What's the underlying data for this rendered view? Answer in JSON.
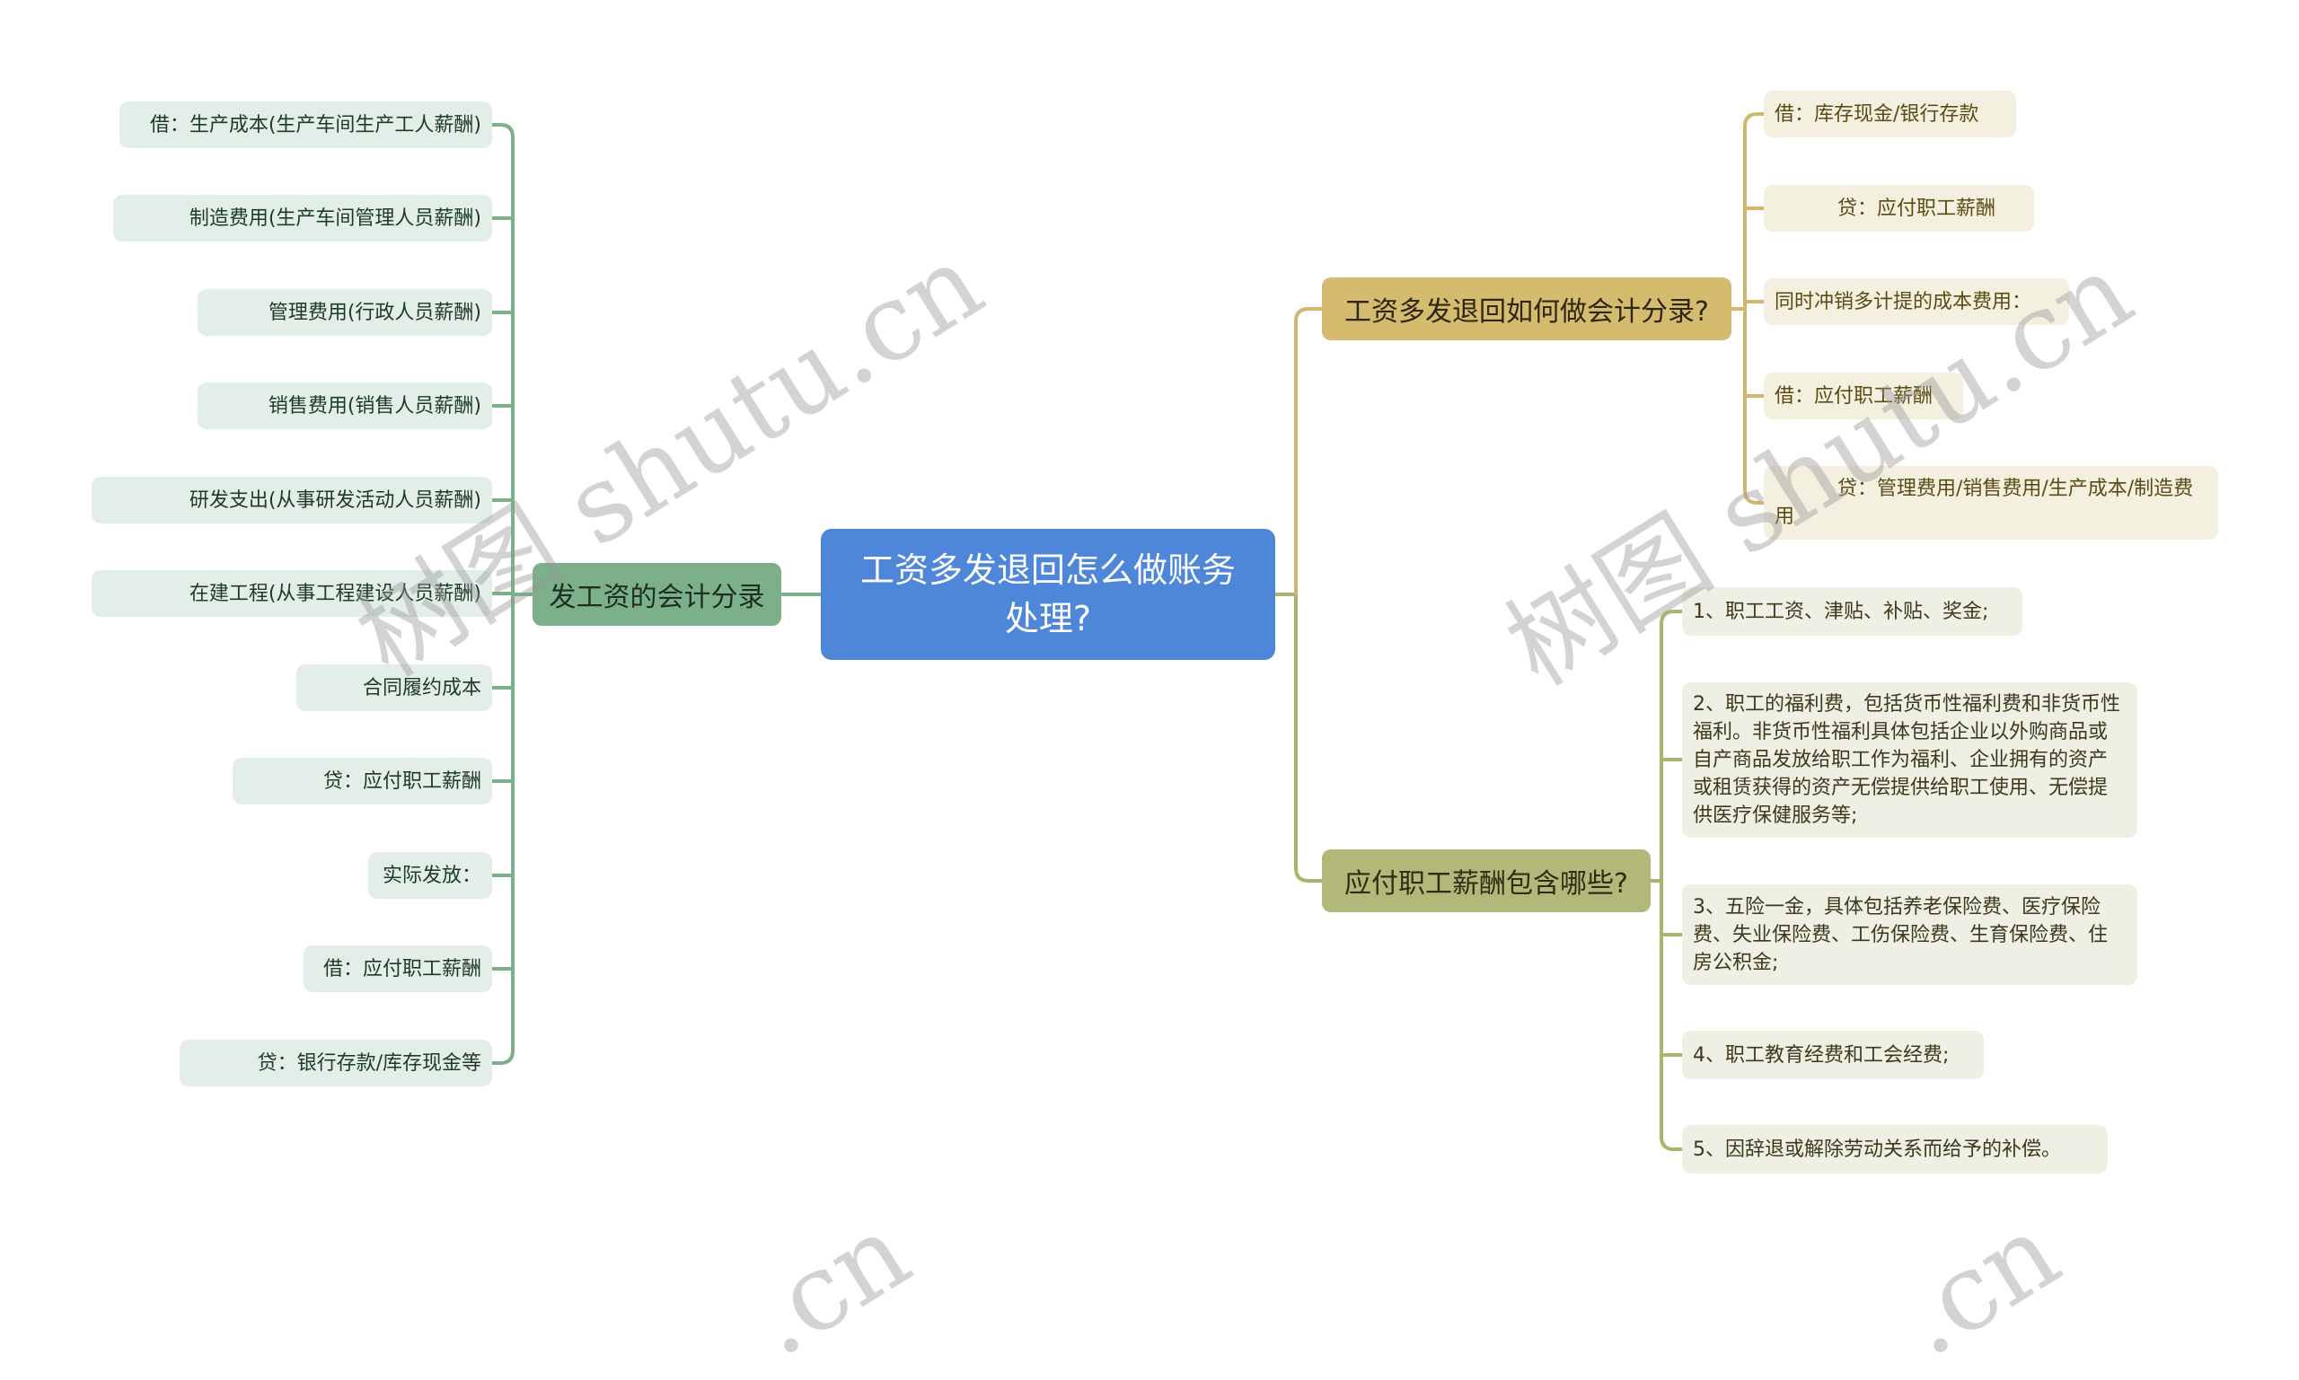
{
  "root": {
    "title": "工资多发退回怎么做账务处理?"
  },
  "branches": {
    "left": {
      "title": "发工资的会计分录",
      "items": [
        "借：生产成本(生产车间生产工人薪酬)",
        "制造费用(生产车间管理人员薪酬)",
        "管理费用(行政人员薪酬)",
        "销售费用(销售人员薪酬)",
        "研发支出(从事研发活动人员薪酬)",
        "在建工程(从事工程建设人员薪酬)",
        "合同履约成本",
        "贷：应付职工薪酬",
        "实际发放：",
        "借：应付职工薪酬",
        "贷：银行存款/库存现金等"
      ]
    },
    "right_top": {
      "title": "工资多发退回如何做会计分录?",
      "items": [
        "借：库存现金/银行存款",
        "          贷：应付职工薪酬",
        "同时冲销多计提的成本费用：",
        "借：应付职工薪酬",
        "          贷：管理费用/销售费用/生产成本/制造费用"
      ]
    },
    "right_bottom": {
      "title": "应付职工薪酬包含哪些?",
      "items": [
        "1、职工工资、津贴、补贴、奖金;",
        "2、职工的福利费，包括货币性福利费和非货币性福利。非货币性福利具体包括企业以外购商品或自产商品发放给职工作为福利、企业拥有的资产或租赁获得的资产无偿提供给职工使用、无偿提供医疗保健服务等;",
        "3、五险一金，具体包括养老保险费、医疗保险费、失业保险费、工伤保险费、生育保险费、住房公积金;",
        "4、职工教育经费和工会经费;",
        "5、因辞退或解除劳动关系而给予的补偿。"
      ]
    }
  },
  "colors": {
    "root": "#4e86d9",
    "left_branch": "#7bb08a",
    "left_line": "#7bb08a",
    "right_top_branch": "#d4bb6d",
    "right_top_line": "#cfb86e",
    "right_bottom_branch": "#b2b877",
    "right_bottom_line": "#aab46c"
  },
  "watermark": {
    "text_main": "树图 shutu.cn",
    "text_short": ".cn"
  }
}
